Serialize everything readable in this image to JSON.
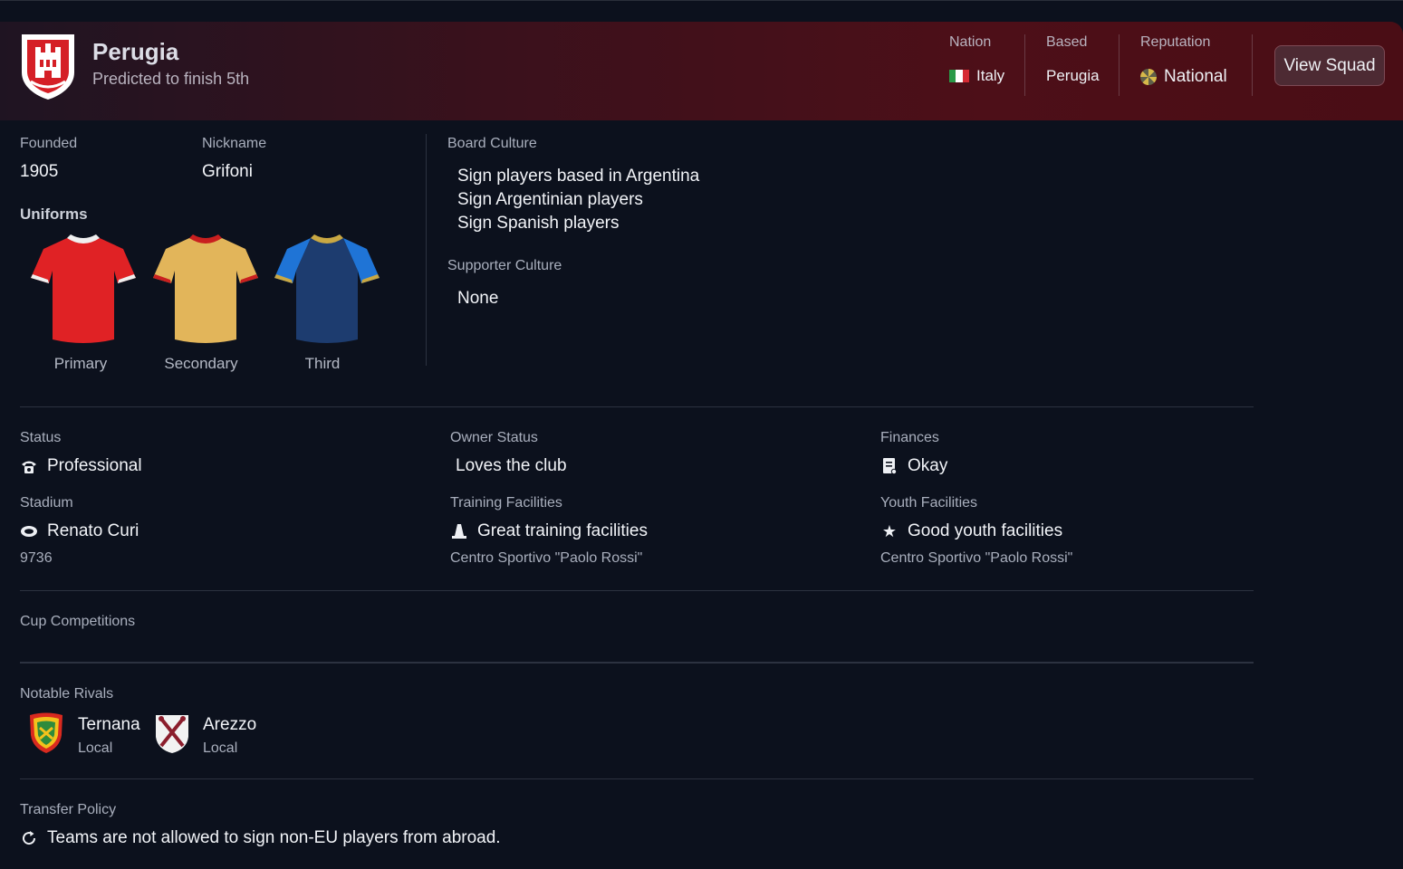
{
  "header": {
    "club_name": "Perugia",
    "prediction": "Predicted to finish 5th",
    "nation_label": "Nation",
    "nation_value": "Italy",
    "based_label": "Based",
    "based_value": "Perugia",
    "reputation_label": "Reputation",
    "reputation_value": "National",
    "view_squad_label": "View Squad"
  },
  "info": {
    "founded_label": "Founded",
    "founded_value": "1905",
    "nickname_label": "Nickname",
    "nickname_value": "Grifoni",
    "uniforms_title": "Uniforms",
    "uniforms": [
      {
        "label": "Primary",
        "body": "#e02225",
        "trim": "#f0f0f0"
      },
      {
        "label": "Secondary",
        "body": "#e2b55a",
        "trim": "#c91f1f"
      },
      {
        "label": "Third",
        "body": "#1d3c6f",
        "trim": "#c9a843",
        "sleeve": "#1f74d6"
      }
    ]
  },
  "culture": {
    "board_label": "Board Culture",
    "board_items": [
      "Sign players based in Argentina",
      "Sign Argentinian players",
      "Sign Spanish players"
    ],
    "supporter_label": "Supporter Culture",
    "supporter_value": "None"
  },
  "details": {
    "status_label": "Status",
    "status_value": "Professional",
    "status_icon": "phone-icon",
    "owner_label": "Owner Status",
    "owner_value": "Loves the club",
    "finances_label": "Finances",
    "finances_value": "Okay",
    "finances_icon": "ledger-icon",
    "stadium_label": "Stadium",
    "stadium_value": "Renato Curi",
    "stadium_capacity": "9736",
    "stadium_icon": "stadium-icon",
    "training_label": "Training Facilities",
    "training_value": "Great training facilities",
    "training_sub": "Centro Sportivo \"Paolo Rossi\"",
    "training_icon": "cone-icon",
    "youth_label": "Youth Facilities",
    "youth_value": "Good youth facilities",
    "youth_sub": "Centro Sportivo \"Paolo Rossi\"",
    "youth_icon": "star-icon"
  },
  "cups": {
    "label": "Cup Competitions"
  },
  "rivals": {
    "label": "Notable Rivals",
    "items": [
      {
        "name": "Ternana",
        "type": "Local"
      },
      {
        "name": "Arezzo",
        "type": "Local"
      }
    ]
  },
  "transfer": {
    "label": "Transfer Policy",
    "value": "Teams are not allowed to sign non-EU players from abroad.",
    "icon": "refresh-icon"
  }
}
